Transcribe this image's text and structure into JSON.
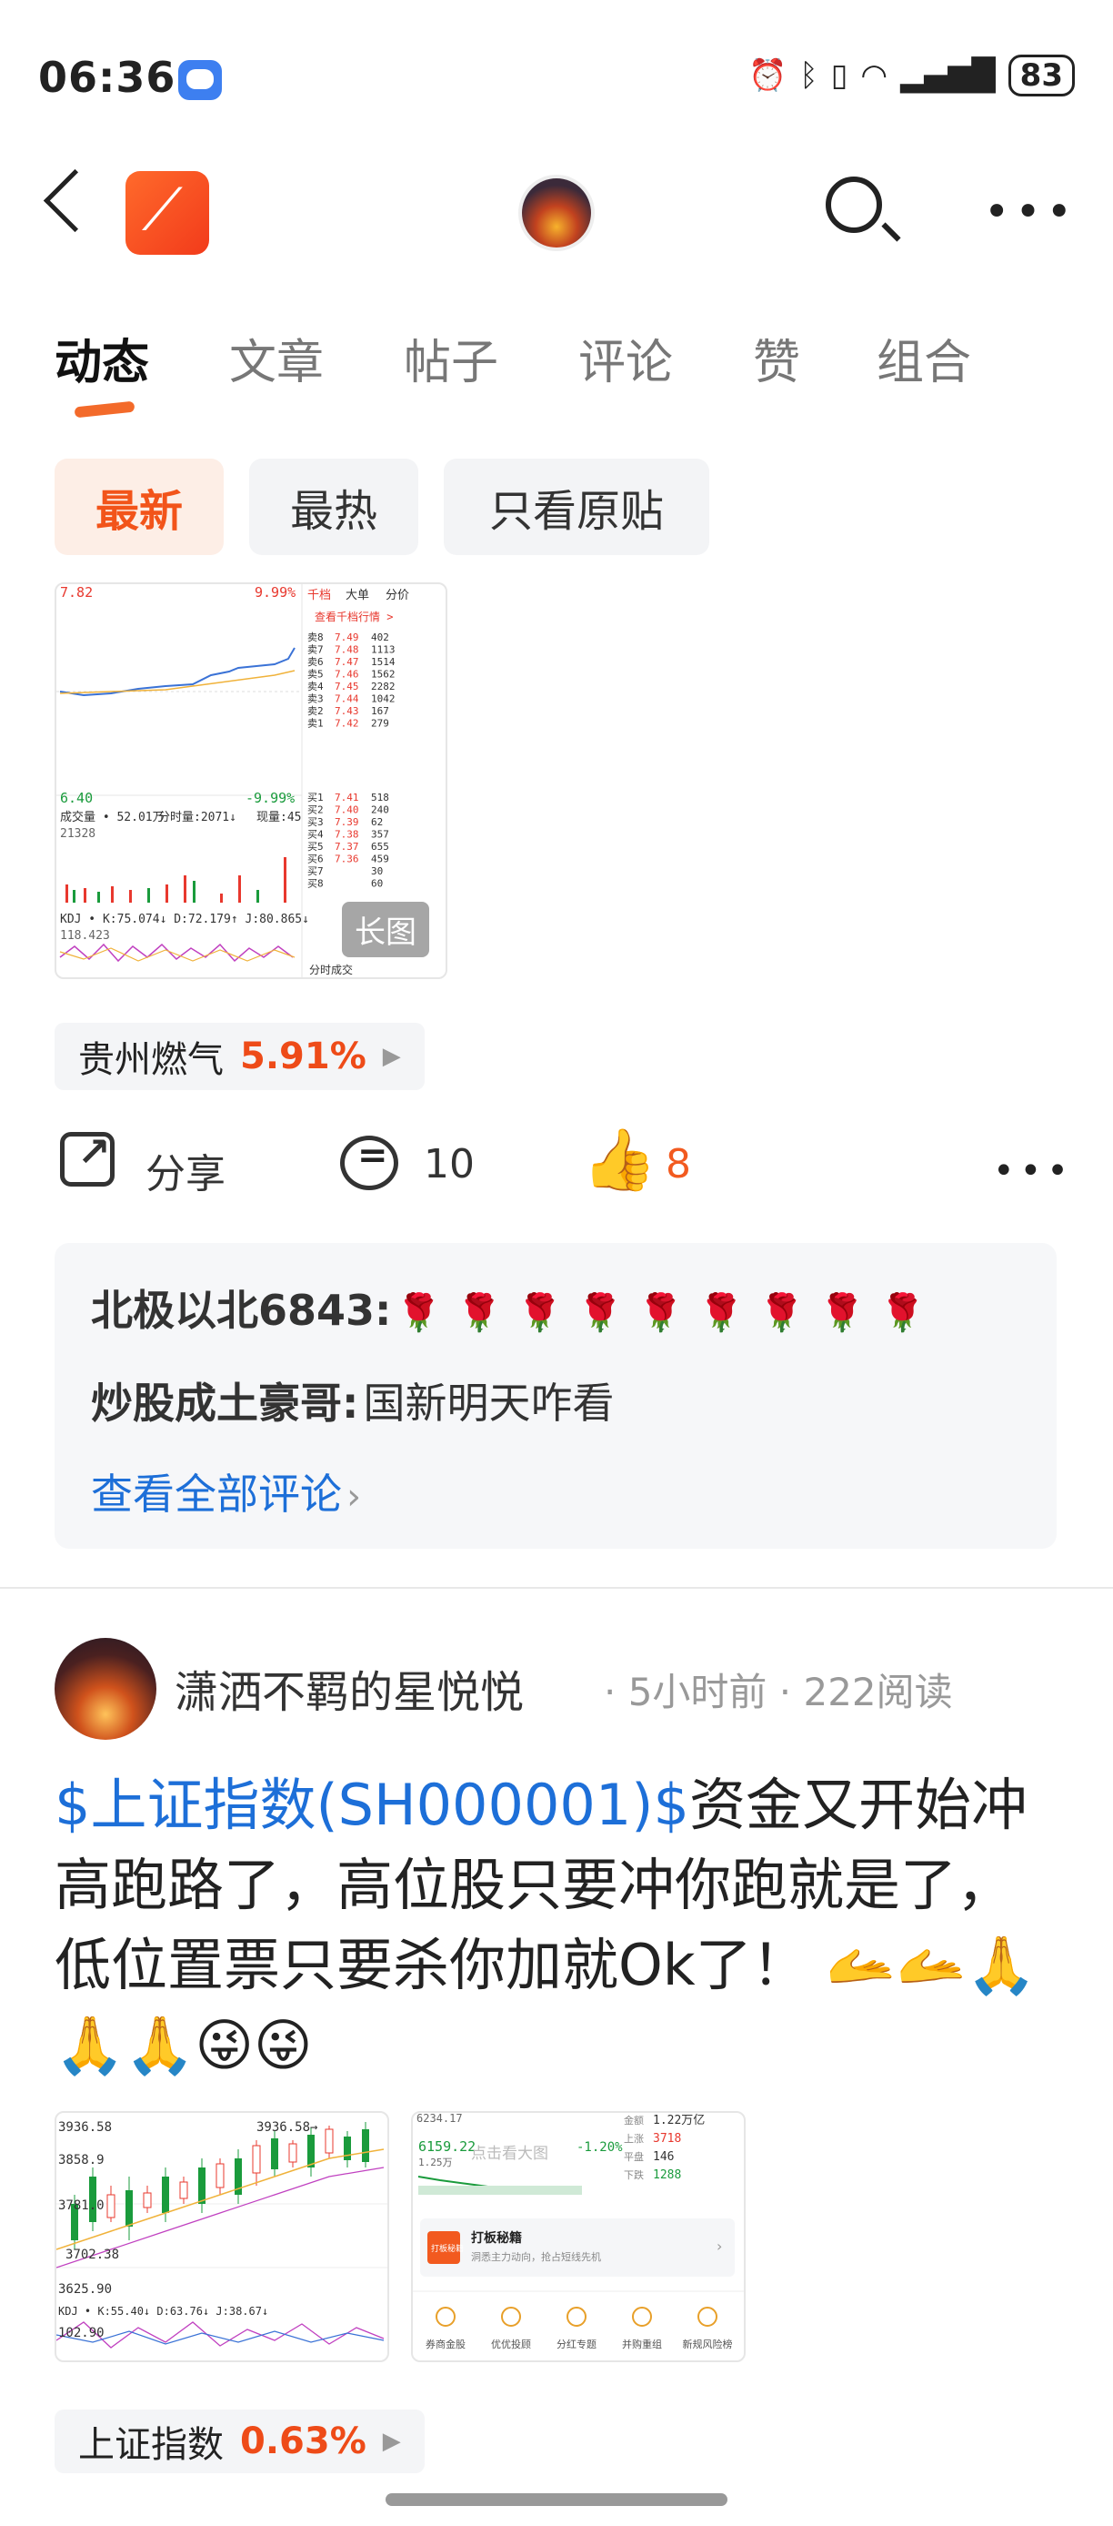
{
  "status_bar": {
    "time": "06:36",
    "battery": "83"
  },
  "tabs": [
    {
      "label": "动态",
      "active": true
    },
    {
      "label": "文章"
    },
    {
      "label": "帖子"
    },
    {
      "label": "评论"
    },
    {
      "label": "赞"
    },
    {
      "label": "组合"
    }
  ],
  "filters": [
    {
      "label": "最新",
      "active": true
    },
    {
      "label": "最热"
    },
    {
      "label": "只看原贴"
    }
  ],
  "post1": {
    "image_tag": "长图",
    "chart_texts": {
      "price_high": "7.82",
      "pct_high": "9.99%",
      "price_low": "6.40",
      "pct_low": "-9.99%",
      "volume": "成交量 • 52.01万",
      "minute_vol": "分时量:2071↓",
      "now_vol": "现量:45",
      "vol_num": "21328",
      "kdj": "KDJ • K:75.074↓ D:72.179↑ J:80.865↓",
      "kdj_num": "118.423",
      "tabs": [
        "千档",
        "大单",
        "分价"
      ],
      "view_depth": "查看千档行情 >",
      "sell": [
        [
          "卖8",
          "7.49",
          "402"
        ],
        [
          "卖7",
          "7.48",
          "1113"
        ],
        [
          "卖6",
          "7.47",
          "1514"
        ],
        [
          "卖5",
          "7.46",
          "1562"
        ],
        [
          "卖4",
          "7.45",
          "2282"
        ],
        [
          "卖3",
          "7.44",
          "1042"
        ],
        [
          "卖2",
          "7.43",
          "167"
        ],
        [
          "卖1",
          "7.42",
          "279"
        ]
      ],
      "buy": [
        [
          "买1",
          "7.41",
          "518"
        ],
        [
          "买2",
          "7.40",
          "240"
        ],
        [
          "买3",
          "7.39",
          "62"
        ],
        [
          "买4",
          "7.38",
          "357"
        ],
        [
          "买5",
          "7.37",
          "655"
        ],
        [
          "买6",
          "7.36",
          "459"
        ],
        [
          "买7",
          "",
          "30"
        ],
        [
          "买8",
          "",
          "60"
        ]
      ],
      "tick_label": "分时成交"
    },
    "stock_tag": {
      "name": "贵州燃气",
      "pct": "5.91%"
    },
    "actions": {
      "share": "分享",
      "comments": "10",
      "likes": "8"
    },
    "comments": [
      {
        "user": "北极以北6843",
        "sep": ":",
        "text": "🌹 🌹 🌹 🌹 🌹 🌹 🌹 🌹 🌹"
      },
      {
        "user": "炒股成土豪哥",
        "sep": ":",
        "text": "国新明天咋看"
      }
    ],
    "view_all": "查看全部评论"
  },
  "post2": {
    "user": "潇洒不羁的星悦悦",
    "meta": "· 5小时前 · 222阅读",
    "link_text": "$上证指数(SH000001)$",
    "body_text": "资金又开始冲高跑路了，高位股只要冲你跑就是了，低位置票只要杀你加就Ok了！ 🫴🫴🙏🙏🙏😜😜",
    "thumb_left": {
      "price_top": "3936.58",
      "price_mid": "3858.9",
      "price_2": "3781.0",
      "low_label": "3702.38",
      "price_low": "3625.90",
      "kdj": "KDJ • K:55.40↓ D:63.76↓ J:38.67↓",
      "kdj_num": "102.90",
      "marker": "3936.58→"
    },
    "thumb_right": {
      "top_num": "6234.17",
      "index_val": "6159.22",
      "pct": "-1.20%",
      "vol": "1.25万",
      "overlay": "点击看大图",
      "stats": [
        [
          "金额",
          "1.22万亿"
        ],
        [
          "上涨",
          "3718"
        ],
        [
          "平盘",
          "146"
        ],
        [
          "下跌",
          "1288"
        ]
      ],
      "promo_badge": "打板秘籍",
      "promo_title": "打板秘籍",
      "promo_desc": "洞悉主力动向，抢占短线先机",
      "menu": [
        "券商金股",
        "优优投顾",
        "分红专题",
        "并购重组",
        "新规风险榜"
      ]
    },
    "stock_tag": {
      "name": "上证指数",
      "pct": "0.63%"
    }
  },
  "colors": {
    "accent": "#f2541a",
    "link": "#1d6fd8",
    "up": "#e8382e",
    "down": "#1a9b3c"
  }
}
